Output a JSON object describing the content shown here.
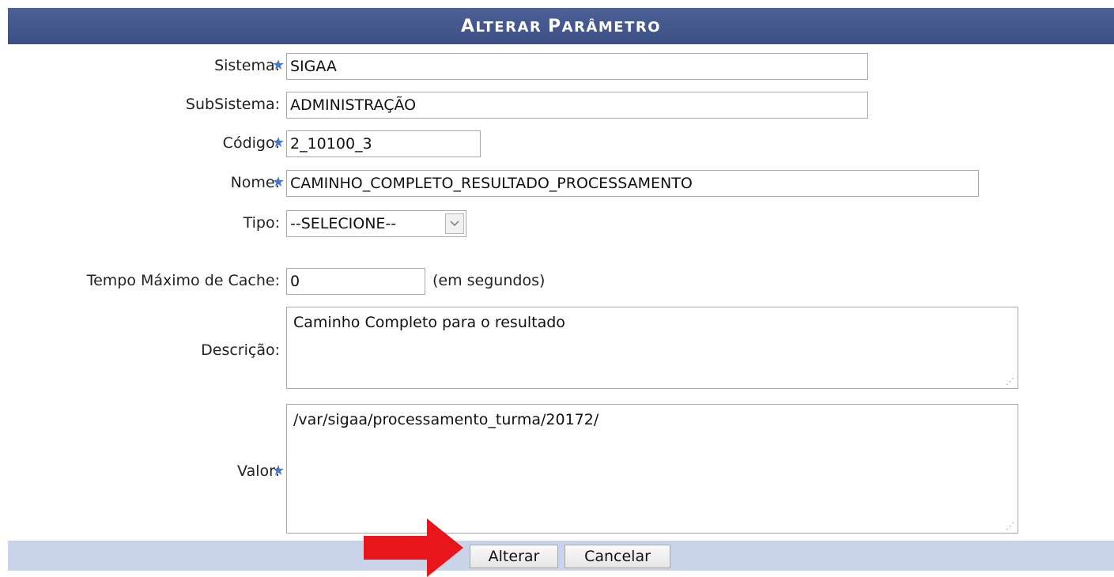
{
  "header": {
    "title_first": "A",
    "title_rest": "LTERAR ",
    "title_second": "P",
    "title_second_rest": "ARÂMETRO"
  },
  "fields": {
    "sistema": {
      "label": "Sistema:",
      "value": "SIGAA",
      "required": true
    },
    "subsistema": {
      "label": "SubSistema:",
      "value": "ADMINISTRAÇÃO",
      "required": false
    },
    "codigo": {
      "label": "Código:",
      "value": "2_10100_3",
      "required": true
    },
    "nome": {
      "label": "Nome:",
      "value": "CAMINHO_COMPLETO_RESULTADO_PROCESSAMENTO",
      "required": true
    },
    "tipo": {
      "label": "Tipo:",
      "selected": "--SELECIONE--",
      "required": false
    },
    "cache": {
      "label": "Tempo Máximo de Cache:",
      "value": "0",
      "suffix": "(em segundos)"
    },
    "descricao": {
      "label": "Descrição:",
      "value": "Caminho Completo para o resultado"
    },
    "valor": {
      "label": "Valor:",
      "value": "/var/sigaa/processamento_turma/20172/",
      "required": true
    }
  },
  "buttons": {
    "submit": "Alterar",
    "cancel": "Cancelar"
  },
  "icons": {
    "required": "star-icon",
    "dropdown": "chevron-down-icon",
    "pointer": "red-arrow-icon"
  },
  "colors": {
    "header_bg": "#3f5289",
    "footer_bg": "#c9d4ea",
    "required_star": "#4a78c8",
    "arrow": "#e8161b"
  }
}
